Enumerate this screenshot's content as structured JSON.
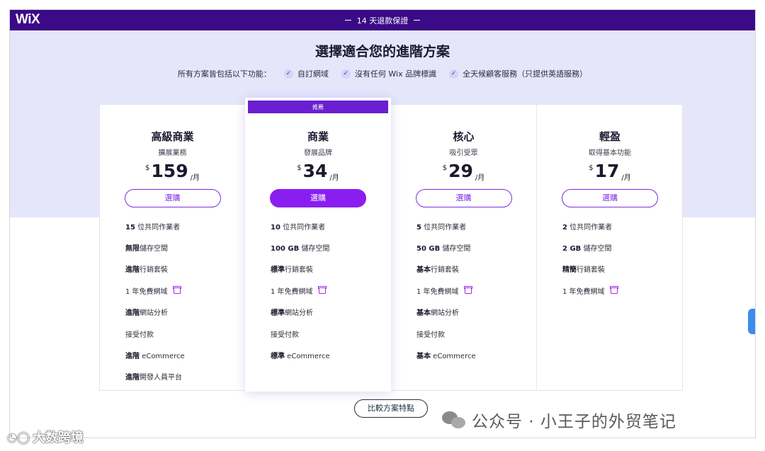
{
  "header": {
    "logo": "WiX",
    "guarantee": "14 天退款保證"
  },
  "hero": {
    "title": "選擇適合您的進階方案",
    "features_intro": "所有方案皆包括以下功能：",
    "features": [
      "自訂網域",
      "沒有任何 Wix 品牌標識",
      "全天候顧客服務（只提供英語服務）"
    ]
  },
  "plans": [
    {
      "name": "高級商業",
      "subtitle": "擴展業務",
      "currency": "$",
      "price": "159",
      "period": "/月",
      "button": "選購",
      "features": [
        {
          "bold": "15",
          "text": " 位共同作業者",
          "gift": false
        },
        {
          "bold": "無限",
          "text": "儲存空間",
          "gift": false
        },
        {
          "bold": "進階",
          "text": "行銷套裝",
          "gift": false
        },
        {
          "bold": "",
          "text": "1 年免費網域",
          "gift": true
        },
        {
          "bold": "進階",
          "text": "網站分析",
          "gift": false
        },
        {
          "bold": "",
          "text": "接受付款",
          "gift": false
        },
        {
          "bold": "進階",
          "text": " eCommerce",
          "gift": false
        },
        {
          "bold": "進階",
          "text": "開發人員平台",
          "gift": false
        }
      ]
    },
    {
      "name": "商業",
      "subtitle": "發展品牌",
      "currency": "$",
      "price": "34",
      "period": "/月",
      "button": "選購",
      "ribbon": "推薦",
      "features": [
        {
          "bold": "10",
          "text": " 位共同作業者",
          "gift": false
        },
        {
          "bold": "100 GB",
          "text": " 儲存空間",
          "gift": false
        },
        {
          "bold": "標準",
          "text": "行銷套裝",
          "gift": false
        },
        {
          "bold": "",
          "text": "1 年免費網域",
          "gift": true
        },
        {
          "bold": "標準",
          "text": "網站分析",
          "gift": false
        },
        {
          "bold": "",
          "text": "接受付款",
          "gift": false
        },
        {
          "bold": "標準",
          "text": " eCommerce",
          "gift": false
        }
      ]
    },
    {
      "name": "核心",
      "subtitle": "吸引受眾",
      "currency": "$",
      "price": "29",
      "period": "/月",
      "button": "選購",
      "features": [
        {
          "bold": "5",
          "text": " 位共同作業者",
          "gift": false
        },
        {
          "bold": "50 GB",
          "text": " 儲存空間",
          "gift": false
        },
        {
          "bold": "基本",
          "text": "行銷套裝",
          "gift": false
        },
        {
          "bold": "",
          "text": "1 年免費網域",
          "gift": true
        },
        {
          "bold": "基本",
          "text": "網站分析",
          "gift": false
        },
        {
          "bold": "",
          "text": "接受付款",
          "gift": false
        },
        {
          "bold": "基本",
          "text": " eCommerce",
          "gift": false
        }
      ]
    },
    {
      "name": "輕盈",
      "subtitle": "取得基本功能",
      "currency": "$",
      "price": "17",
      "period": "/月",
      "button": "選購",
      "features": [
        {
          "bold": "2",
          "text": " 位共同作業者",
          "gift": false
        },
        {
          "bold": "2 GB",
          "text": " 儲存空間",
          "gift": false
        },
        {
          "bold": "精簡",
          "text": "行銷套裝",
          "gift": false
        },
        {
          "bold": "",
          "text": "1 年免費網域",
          "gift": true
        }
      ]
    }
  ],
  "compare_button": "比較方案特點",
  "watermarks": {
    "right": "公众号 · 小王子的外贸笔记",
    "left": "大数跨境"
  },
  "colors": {
    "topbar": "#3b0a87",
    "hero_bg": "#e6e6fb",
    "accent": "#8a1ef0"
  }
}
